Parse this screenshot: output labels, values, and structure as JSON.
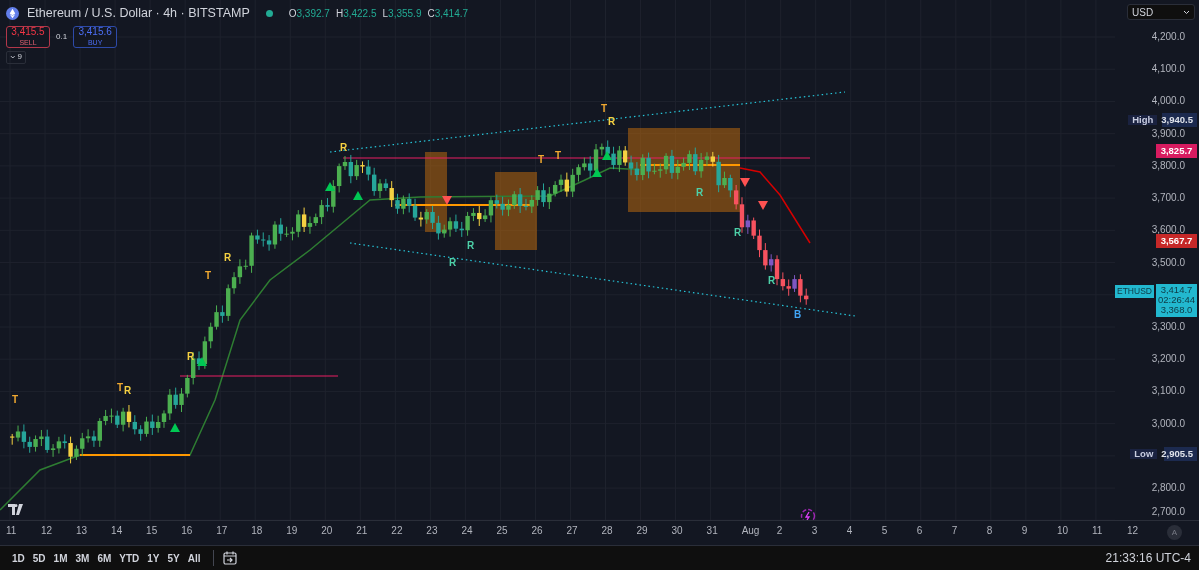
{
  "header": {
    "symbol_title": "Ethereum / U.S. Dollar · 4h · BITSTAMP",
    "market_open": true,
    "ohlc": [
      {
        "label": "O",
        "value": "3,392.7"
      },
      {
        "label": "H",
        "value": "3,422.5"
      },
      {
        "label": "L",
        "value": "3,355.9"
      },
      {
        "label": "C",
        "value": "3,414.7"
      }
    ],
    "sell": {
      "price": "3,415.5",
      "label": "SELL"
    },
    "spread": "0.1",
    "buy": {
      "price": "3,415.6",
      "label": "BUY"
    },
    "indicators_toggle": "9"
  },
  "price_axis": {
    "currency": "USD",
    "ticks": [
      "4,200.0",
      "4,100.0",
      "4,000.0",
      "3,900.0",
      "3,800.0",
      "3,700.0",
      "3,600.0",
      "3,500.0",
      "3,300.0",
      "3,200.0",
      "3,100.0",
      "3,000.0",
      "2,800.0",
      "2,700.0"
    ],
    "badges": [
      {
        "kind": "high",
        "label": "High",
        "value": "3,940.5"
      },
      {
        "kind": "level",
        "value": "3,825.7",
        "color": "#d81b60"
      },
      {
        "kind": "level",
        "value": "3,567.7",
        "color": "#c62828"
      },
      {
        "kind": "last",
        "label": "ETHUSD",
        "value": "3,414.7",
        "countdown": "02:26:44",
        "color": "#22b8cf"
      },
      {
        "kind": "level",
        "value": "3,368.0",
        "color": "#22b8cf"
      },
      {
        "kind": "low",
        "label": "Low",
        "value": "2,905.5"
      }
    ],
    "auto_scale": "A"
  },
  "chart": {
    "markers": [
      {
        "text": "T",
        "color": "#f0a830"
      },
      {
        "text": "T",
        "color": "#f0a830"
      },
      {
        "text": "R",
        "color": "#f5d142"
      },
      {
        "text": "R",
        "color": "#f5d142"
      },
      {
        "text": "T",
        "color": "#f0a830"
      },
      {
        "text": "R",
        "color": "#f5d142"
      },
      {
        "text": "R",
        "color": "#f5d142"
      },
      {
        "text": "R",
        "color": "#4dd0a8"
      },
      {
        "text": "R",
        "color": "#4dd0a8"
      },
      {
        "text": "T",
        "color": "#f0a830"
      },
      {
        "text": "T",
        "color": "#f0a830"
      },
      {
        "text": "T",
        "color": "#f0a830"
      },
      {
        "text": "R",
        "color": "#f5d142"
      },
      {
        "text": "R",
        "color": "#4dd0a8"
      },
      {
        "text": "R",
        "color": "#4dd0a8"
      },
      {
        "text": "R",
        "color": "#4dd0a8"
      },
      {
        "text": "B",
        "color": "#42a5f5"
      }
    ]
  },
  "time_axis": [
    "11",
    "12",
    "13",
    "14",
    "15",
    "16",
    "17",
    "18",
    "19",
    "20",
    "21",
    "22",
    "23",
    "24",
    "25",
    "26",
    "27",
    "28",
    "29",
    "30",
    "31",
    "Aug",
    "2",
    "3",
    "4",
    "5",
    "6",
    "7",
    "8",
    "9",
    "10",
    "11",
    "12"
  ],
  "bottom_toolbar": {
    "ranges": [
      "1D",
      "5D",
      "1M",
      "3M",
      "6M",
      "YTD",
      "1Y",
      "5Y",
      "All"
    ],
    "clock": "21:33:16 UTC-4"
  }
}
